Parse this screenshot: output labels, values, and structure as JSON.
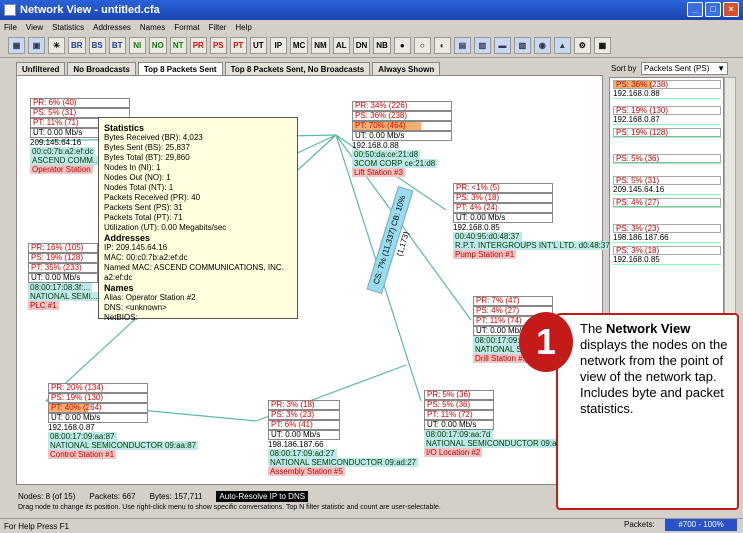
{
  "window": {
    "title": "Network View - untitled.cfa",
    "btn_min": "_",
    "btn_max": "□",
    "btn_close": "×"
  },
  "menu": [
    "File",
    "View",
    "Statistics",
    "Addresses",
    "Names",
    "Format",
    "Filter",
    "Help"
  ],
  "toolbar": [
    "BR",
    "BS",
    "BT",
    "NI",
    "NO",
    "NT",
    "PR",
    "PS",
    "PT",
    "UT",
    "IP",
    "MC",
    "NM",
    "AL",
    "DN",
    "NB"
  ],
  "tabs": [
    "Unfiltered",
    "No Broadcasts",
    "Top 8 Packets Sent",
    "Top 8 Packets Sent, No Broadcasts",
    "Always Shown"
  ],
  "sort": {
    "label": "Sort by",
    "value": "Packets Sent (PS)"
  },
  "sort_list": [
    {
      "bar": "PS: 36% (238)",
      "fill": 0.36,
      "ip": "192.168.0.88"
    },
    {
      "bar": "PS: 19% (130)",
      "fill": 0.19,
      "ip": "192.168.0.87"
    },
    {
      "bar": "PS: 19% (128)",
      "fill": 0.19,
      "ip": ""
    },
    {
      "bar": "PS: 5% (36)",
      "fill": 0.05,
      "ip": ""
    },
    {
      "bar": "PS: 5% (31)",
      "fill": 0.05,
      "ip": "209.145.64.16"
    },
    {
      "bar": "PS: 4% (27)",
      "fill": 0.04,
      "ip": ""
    },
    {
      "bar": "PS: 3% (23)",
      "fill": 0.03,
      "ip": "198.186.187.66"
    },
    {
      "bar": "PS: 3% (18)",
      "fill": 0.03,
      "ip": "192.168.0.85"
    }
  ],
  "nodes": {
    "op": {
      "pr": "PR: 6% (40)",
      "ps": "PS: 5% (31)",
      "pt": "PT: 11% (71)",
      "ut": "UT: 0.00 Mb/s",
      "ip": "209.145.64.16",
      "mac": "00:c0:7b:a2:ef:dc",
      "org": "ASCEND COMM...",
      "name": "Operator Station"
    },
    "lift": {
      "pr": "PR: 34% (226)",
      "ps": "PS: 36% (238)",
      "pt": "PT: 70% (464)",
      "ut": "UT: 0.00 Mb/s",
      "ip": "192.168.0.88",
      "mac": "00:50:da:ce:21:d8",
      "org": "3COM CORP ce:21:d8",
      "name": "Lift Station #3"
    },
    "pump": {
      "pr": "PR: <1% (5)",
      "ps": "PS: 3% (18)",
      "pt": "PT: 4% (24)",
      "ut": "UT: 0.00 Mb/s",
      "ip": "192.168.0.85",
      "mac": "00:40:95:d0:48:37",
      "org": "R.P.T. INTERGROUPS INT'L LTD. d0:48:37",
      "name": "Pump Station #1"
    },
    "plc": {
      "pr": "PR: 16% (105)",
      "ps": "PS: 19% (128)",
      "pt": "PT: 35% (233)",
      "ut": "UT: 0.00 Mb/s",
      "ip": "",
      "mac": "08:00:17:08:3f:...",
      "org": "NATIONAL SEMI...",
      "name": "PLC #1"
    },
    "drill": {
      "pr": "PR: 7% (47)",
      "ps": "PS: 4% (27)",
      "pt": "PT: 11% (74)",
      "ut": "UT: 0.00 Mb/s",
      "ip": "",
      "mac": "08:00:17:09:...",
      "org": "NATIONAL SE...",
      "name": "Drill Station #..."
    },
    "control": {
      "pr": "PR: 20% (134)",
      "ps": "PS: 19% (130)",
      "pt": "PT: 40% (264)",
      "ut": "UT: 0.00 Mb/s",
      "ip": "192.168.0.87",
      "mac": "08:00:17:09:aa:87",
      "org": "NATIONAL SEMICONDUCTOR 09:aa:87",
      "name": "Control Station #1"
    },
    "assembly": {
      "pr": "PR: 3% (18)",
      "ps": "PS: 3% (23)",
      "pt": "PT: 6% (41)",
      "ut": "UT: 0.00 Mb/s",
      "ip": "198.186.187.66",
      "mac": "08:00:17:09:ad:27",
      "org": "NATIONAL SEMICONDUCTOR 09:ad:27",
      "name": "Assembly Station #5"
    },
    "io": {
      "pr": "PR: 5% (36)",
      "ps": "PS: 5% (36)",
      "pt": "PT: 11% (72)",
      "ut": "UT: 0.00 Mb/s",
      "ip": "",
      "mac": "08:00:17:09:aa:7d",
      "org": "NATIONAL SEMICONDUCTOR 09:aa:7d",
      "name": "I/O Location #2"
    }
  },
  "popup": {
    "stats_head": "Statistics",
    "stats": [
      "Bytes Received (BR): 4,023",
      "Bytes Sent (BS): 25,837",
      "Bytes Total (BT): 29,860",
      "Nodes In (NI): 1",
      "Nodes Out (NO): 1",
      "Nodes Total (NT): 1",
      "Packets Received (PR): 40",
      "Packets Sent (PS): 31",
      "Packets Total (PT): 71",
      "Utilization (UT): 0.00 Megabits/sec"
    ],
    "addr_head": "Addresses",
    "addrs": [
      "IP: 209.145.64.16",
      "MAC: 00:c0:7b:a2:ef:dc",
      "Named MAC: ASCEND COMMUNICATIONS, INC. a2:ef:dc"
    ],
    "names_head": "Names",
    "names": [
      "Alias: Operator Station #2",
      "DNS: <unknown>",
      "NetBIOS:"
    ]
  },
  "link_label": "CS: 7% (11,337)  CB: 10% (1,173)",
  "status": {
    "nodes": "Nodes: 8 (of 15)",
    "packets": "Packets: 667",
    "bytes": "Bytes: 157,711",
    "auto": "Auto-Resolve IP to DNS"
  },
  "hint": "Drag node to change its position. Use right-click menu to show specific conversations. Top N filter statistic and count are user-selectable.",
  "help": "For Help Press F1",
  "packets_label": "Packets:",
  "packets_value": "#700 - 100%",
  "callout": {
    "number": "1",
    "pre": "The",
    "bold": "Network View",
    "rest": "displays the nodes on the network from the point of view of the network tap. Includes byte and packet statistics."
  }
}
